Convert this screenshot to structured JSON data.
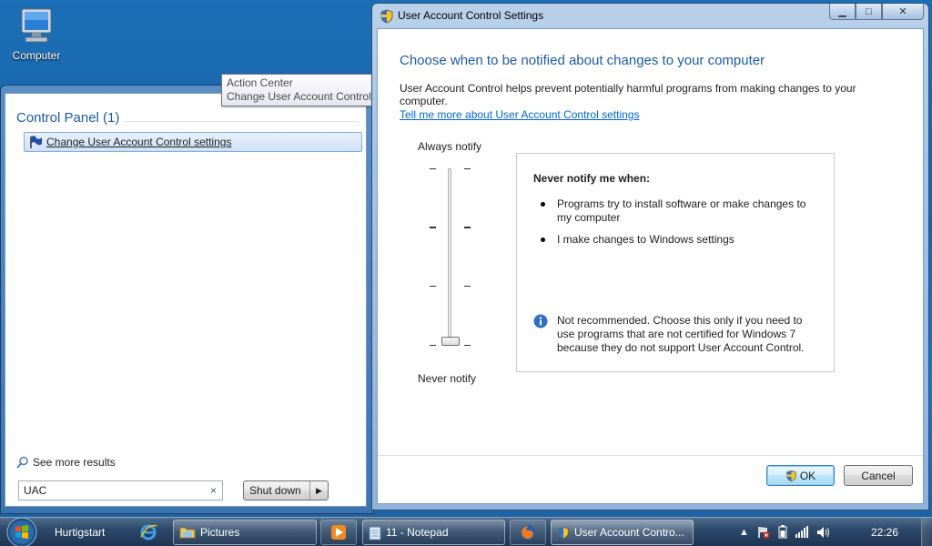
{
  "desktop": {
    "computer_icon_label": "Computer"
  },
  "start_menu": {
    "group_header": "Control Panel (1)",
    "result_label": "Change User Account Control settings",
    "tooltip_line1": "Action Center",
    "tooltip_line2": "Change User Account Control settings",
    "see_more": "See more results",
    "search_value": "UAC",
    "search_clear": "×",
    "shutdown_label": "Shut down",
    "shutdown_arrow": "▶"
  },
  "uac_window": {
    "title": "User Account Control Settings",
    "heading": "Choose when to be notified about changes to your computer",
    "description": "User Account Control helps prevent potentially harmful programs from making changes to your computer.",
    "link": "Tell me more about User Account Control settings",
    "slider_top_label": "Always notify",
    "slider_bottom_label": "Never notify",
    "slider": {
      "positions": 4,
      "selected_index": 3
    },
    "info_title": "Never notify me when:",
    "info_bullets": [
      "Programs try to install software or make changes to my computer",
      "I make changes to Windows settings"
    ],
    "info_note": "Not recommended. Choose this only if you need to use programs that are not certified for Windows 7 because they do not support User Account Control.",
    "ok_label": "OK",
    "cancel_label": "Cancel",
    "min_glyph": "▁",
    "max_glyph": "□",
    "close_glyph": "✕"
  },
  "taskbar": {
    "quicklaunch_label": "Hurtigstart",
    "items": [
      {
        "label": "Pictures"
      },
      {
        "label": "11 - Notepad"
      },
      {
        "label": "User Account Contro..."
      }
    ],
    "clock": "22:26"
  },
  "colors": {
    "heading_blue": "#1e5aa0",
    "link_blue": "#0066cc",
    "info_icon_blue": "#2b6fc9"
  }
}
